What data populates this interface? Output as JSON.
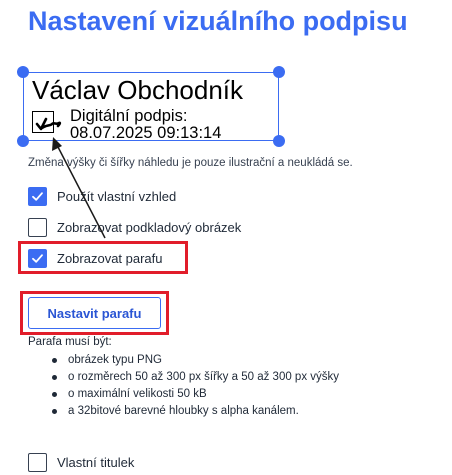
{
  "page_title": "Nastavení vizuálního podpisu",
  "preview": {
    "name": "Václav Obchodník",
    "signature_label": "Digitální podpis:",
    "signature_date": "08.07.2025 09:13:14"
  },
  "resize_note": "Změna výšky či šířky náhledu je pouze ilustrační a neukládá se.",
  "options": {
    "custom_look": {
      "label": "Použít vlastní vzhled",
      "checked": true
    },
    "background_image": {
      "label": "Zobrazovat podkladový obrázek",
      "checked": false
    },
    "show_paraf": {
      "label": "Zobrazovat parafu",
      "checked": true
    },
    "custom_title": {
      "label": "Vlastní titulek",
      "checked": false
    }
  },
  "set_paraf_button": "Nastavit parafu",
  "requirements": {
    "title": "Parafa musí být:",
    "items": [
      "obrázek typu PNG",
      "o rozměrech 50 až 300 px šířky a 50 až 300 px výšky",
      "o maximální velikosti 50 kB",
      "a 32bitové barevné hloubky s alpha kanálem."
    ]
  },
  "colors": {
    "accent": "#3b6cf2",
    "highlight": "#e11d2a"
  },
  "icons": [
    "checkmark-icon",
    "paraf-scribble-icon",
    "resize-handle-icon",
    "arrow-annotation"
  ]
}
